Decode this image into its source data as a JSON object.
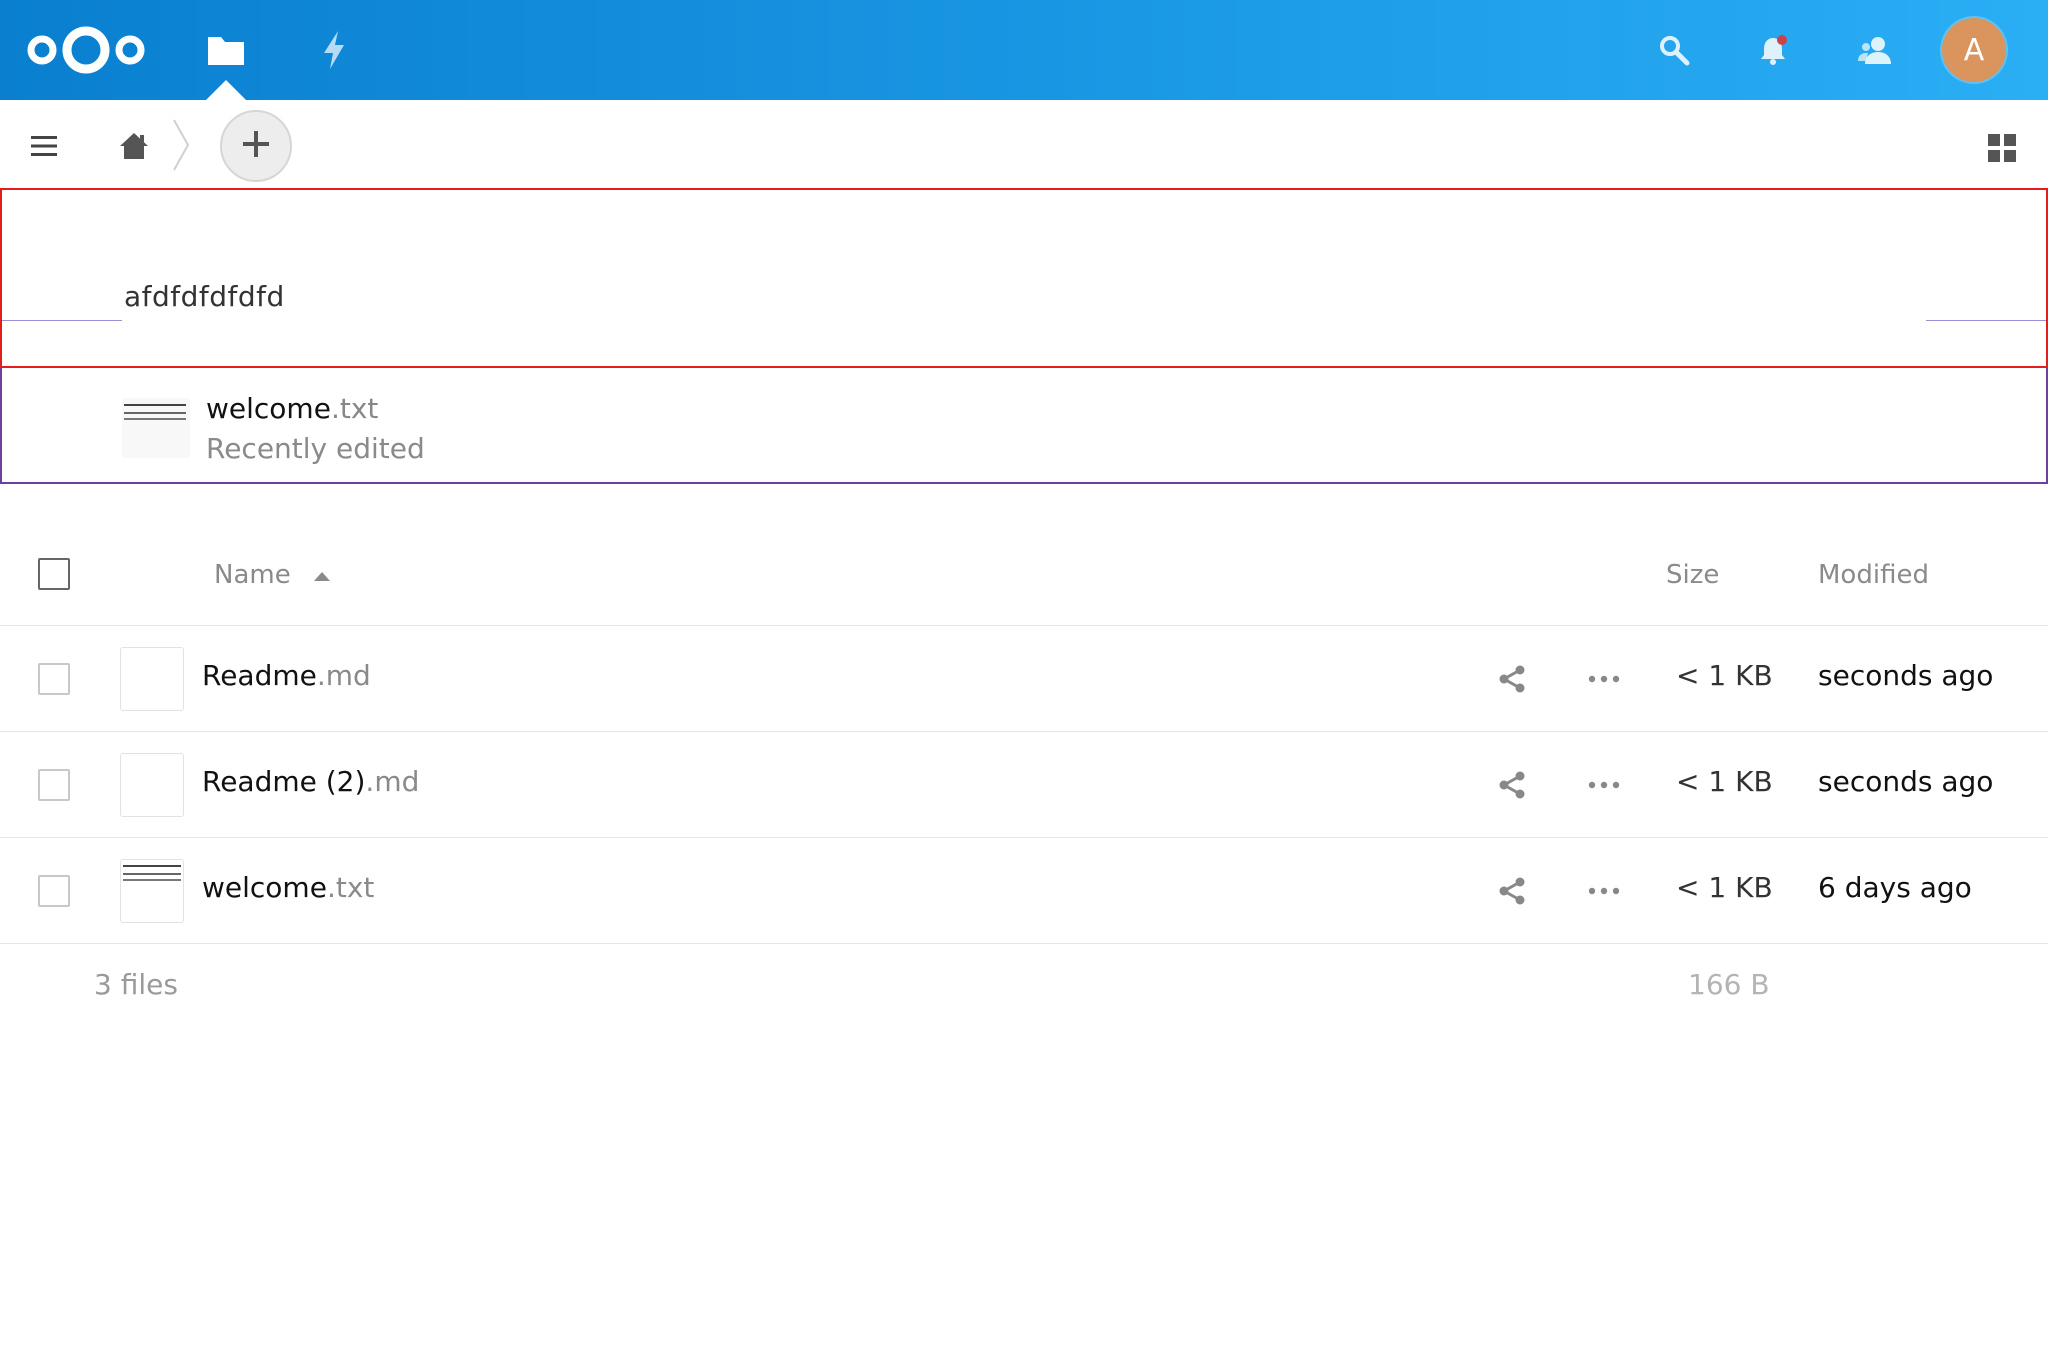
{
  "header": {
    "logo_icon": "nextcloud-logo",
    "apps": [
      {
        "name": "Files",
        "icon": "folder-icon",
        "active": true
      },
      {
        "name": "Activity",
        "icon": "lightning-icon",
        "active": false
      }
    ],
    "right_icons": [
      "search-icon",
      "bell-icon",
      "contacts-icon"
    ],
    "avatar_letter": "A",
    "colors": {
      "gradient_start": "#0a7fd0",
      "gradient_end": "#2aaef4",
      "avatar": "#d9955d",
      "notification_dot": "#e9322d"
    }
  },
  "controls": {
    "menu_icon": "hamburger-menu-icon",
    "home_icon": "home-icon",
    "new_icon": "plus-icon",
    "view_toggle_icon": "grid-view-icon"
  },
  "workspace": {
    "text": "afdfdfdfdfd"
  },
  "recommendation": {
    "file_base": "welcome",
    "file_ext": ".txt",
    "subtitle": "Recently edited"
  },
  "list": {
    "columns": {
      "name": "Name",
      "size": "Size",
      "modified": "Modified"
    },
    "sort": {
      "column": "Name",
      "direction": "ascending"
    },
    "files": [
      {
        "base": "Readme",
        "ext": ".md",
        "size": "< 1 KB",
        "modified": "seconds ago",
        "has_preview": false
      },
      {
        "base": "Readme (2)",
        "ext": ".md",
        "size": "< 1 KB",
        "modified": "seconds ago",
        "has_preview": false
      },
      {
        "base": "welcome",
        "ext": ".txt",
        "size": "< 1 KB",
        "modified": "6 days ago",
        "has_preview": true
      }
    ]
  },
  "summary": {
    "files_count": "3 files",
    "total_size": "166 B"
  }
}
